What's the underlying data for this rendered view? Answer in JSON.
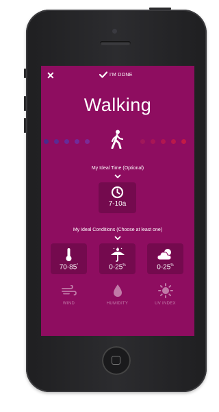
{
  "header": {
    "close_label": "✕",
    "done_label": "I'M DONE"
  },
  "activity": {
    "title": "Walking"
  },
  "time_section": {
    "label": "My Ideal Time (Optional)",
    "value": "7-10a"
  },
  "conditions_section": {
    "label": "My Ideal Conditions (Choose at least one)",
    "cards": [
      {
        "name": "temperature",
        "value": "70-85",
        "unit": "°"
      },
      {
        "name": "precipitation",
        "value": "0-25",
        "unit": "%"
      },
      {
        "name": "cloud-cover",
        "value": "0-25",
        "unit": "%"
      }
    ],
    "options": [
      {
        "name": "wind",
        "label": "WIND"
      },
      {
        "name": "humidity",
        "label": "HUMIDITY"
      },
      {
        "name": "uv-index",
        "label": "UV INDEX"
      }
    ]
  },
  "colors": {
    "screen_bg": "#8e0d60",
    "left_dots": "#6b2a9a",
    "right_dots": "#b01a4a"
  }
}
